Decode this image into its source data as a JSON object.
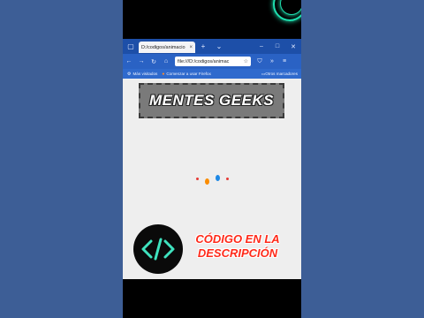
{
  "browser": {
    "tab_title": "D:/codigos/animacio",
    "url": "file:///D:/codigos/animac",
    "bookmarks": {
      "most_visited": "Más visitados",
      "getting_started": "Comenzar a usar Firefox",
      "other_bookmarks": "Otros marcadores"
    }
  },
  "page": {
    "brand_title": "MENTES GEEKS",
    "loader_dots": [
      {
        "color": "#e53935"
      },
      {
        "color": "#fb8c00"
      },
      {
        "color": "#1e88e5"
      },
      {
        "color": "#e53935"
      }
    ]
  },
  "overlay": {
    "promo_line1": "CÓDIGO EN LA",
    "promo_line2": "DESCRIPCIÓN",
    "logo_symbol": "</>"
  },
  "colors": {
    "accent_teal": "#1fe0b0",
    "tabbar": "#1d4fa8",
    "promo_red": "#ff2a1a"
  }
}
